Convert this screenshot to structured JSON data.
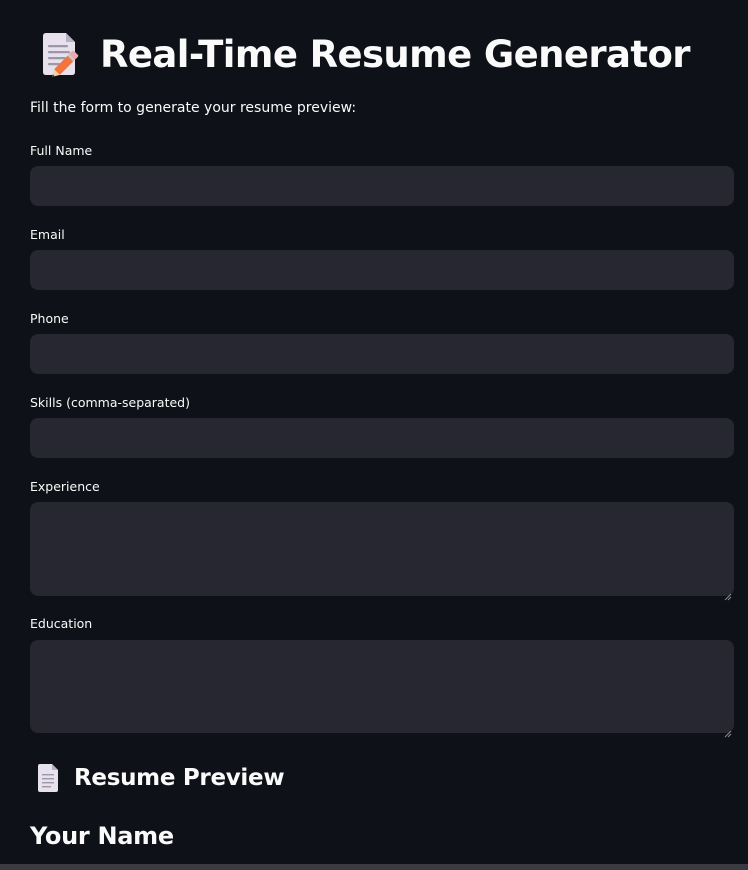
{
  "header": {
    "title": "Real-Time Resume Generator",
    "title_icon": "memo-pencil-icon"
  },
  "intro_text": "Fill the form to generate your resume preview:",
  "form": {
    "full_name": {
      "label": "Full Name",
      "value": ""
    },
    "email": {
      "label": "Email",
      "value": ""
    },
    "phone": {
      "label": "Phone",
      "value": ""
    },
    "skills": {
      "label": "Skills (comma-separated)",
      "value": ""
    },
    "experience": {
      "label": "Experience",
      "value": ""
    },
    "education": {
      "label": "Education",
      "value": ""
    }
  },
  "preview": {
    "heading": "Resume Preview",
    "heading_icon": "page-document-icon",
    "name_placeholder": "Your Name"
  },
  "colors": {
    "background": "#0e1117",
    "input_background": "#262730",
    "text": "#fafafa",
    "accent_pencil": "#f4743a"
  }
}
